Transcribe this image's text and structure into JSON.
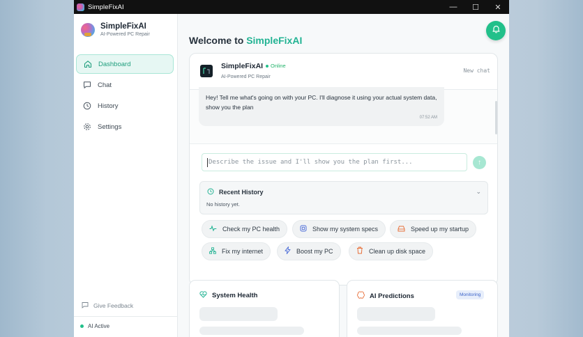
{
  "window": {
    "title": "SimpleFixAI"
  },
  "sidebar": {
    "brand_name": "SimpleFixAI",
    "brand_sub": "AI-Powered PC Repair",
    "items": [
      {
        "label": "Dashboard",
        "icon": "home-icon"
      },
      {
        "label": "Chat",
        "icon": "chat-icon"
      },
      {
        "label": "History",
        "icon": "clock-icon"
      },
      {
        "label": "Settings",
        "icon": "gear-icon"
      }
    ],
    "feedback": "Give Feedback",
    "status": "AI Active"
  },
  "main": {
    "welcome_prefix": "Welcome to",
    "welcome_brand": "SimpleFixAI",
    "chat": {
      "name": "SimpleFixAI",
      "online": "Online",
      "sub": "AI-Powered PC Repair",
      "new_chat": "New chat",
      "message": "Hey! Tell me what's going on with your PC. I'll diagnose it using your actual system data, show you the plan",
      "message_time": "07:52 AM",
      "input_placeholder": "Describe the issue and I'll show you the plan first..."
    },
    "history": {
      "title": "Recent History",
      "empty": "No history yet."
    },
    "quick_actions": [
      {
        "label": "Check my PC health",
        "icon": "pulse-icon"
      },
      {
        "label": "Show my system specs",
        "icon": "cpu-icon"
      },
      {
        "label": "Speed up my startup",
        "icon": "drive-icon"
      },
      {
        "label": "Fix my internet",
        "icon": "network-icon"
      },
      {
        "label": "Boost my PC",
        "icon": "bolt-icon"
      },
      {
        "label": "Clean up disk space",
        "icon": "trash-icon"
      }
    ],
    "panels": {
      "health_title": "System Health",
      "predictions_title": "AI Predictions",
      "predictions_badge": "Monitoring"
    }
  },
  "colors": {
    "accent": "#22c08a",
    "accent_text": "#22b393",
    "titlebar": "#111111"
  }
}
